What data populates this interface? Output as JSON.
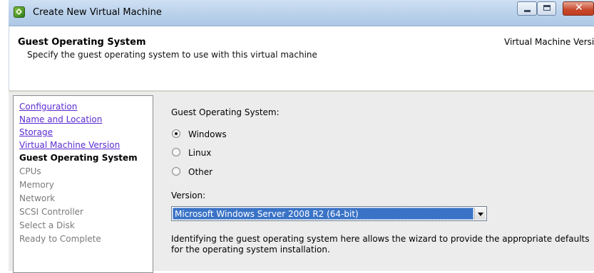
{
  "window": {
    "title": "Create New Virtual Machine",
    "icon": "vsphere-app-icon"
  },
  "header": {
    "title": "Guest Operating System",
    "subtitle": "Specify the guest operating system to use with this virtual machine",
    "version_text": "Virtual Machine Versio"
  },
  "steps": [
    {
      "label": "Configuration",
      "state": "done"
    },
    {
      "label": "Name and Location",
      "state": "done"
    },
    {
      "label": "Storage",
      "state": "done"
    },
    {
      "label": "Virtual Machine Version",
      "state": "done"
    },
    {
      "label": "Guest Operating System",
      "state": "current"
    },
    {
      "label": "CPUs",
      "state": "todo"
    },
    {
      "label": "Memory",
      "state": "todo"
    },
    {
      "label": "Network",
      "state": "todo"
    },
    {
      "label": "SCSI Controller",
      "state": "todo"
    },
    {
      "label": "Select a Disk",
      "state": "todo"
    },
    {
      "label": "Ready to Complete",
      "state": "todo"
    }
  ],
  "form": {
    "os_label": "Guest Operating System:",
    "os_options": [
      {
        "label": "Windows",
        "selected": true
      },
      {
        "label": "Linux",
        "selected": false
      },
      {
        "label": "Other",
        "selected": false
      }
    ],
    "version_label": "Version:",
    "version_value": "Microsoft Windows Server 2008 R2 (64-bit)",
    "description": "Identifying the guest operating system here allows the wizard to provide the appropriate defaults for the operating system installation."
  },
  "colors": {
    "link": "#5a2bd1",
    "selection": "#3a73c6"
  }
}
